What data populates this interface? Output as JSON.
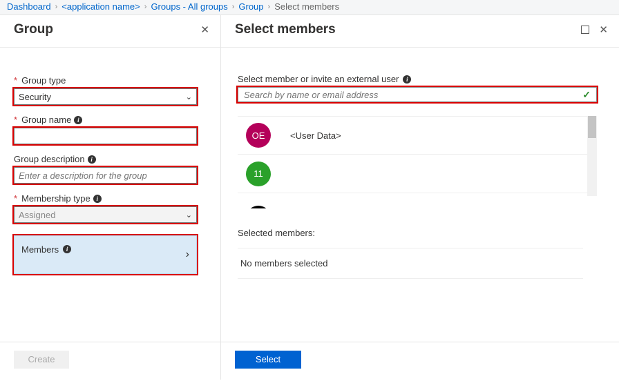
{
  "breadcrumb": {
    "dashboard": "Dashboard",
    "app_name": "<application name>",
    "groups_all": "Groups - All groups",
    "group": "Group",
    "select_members": "Select members"
  },
  "left": {
    "title": "Group",
    "group_type_label": "Group type",
    "group_type_value": "Security",
    "group_name_label": "Group name",
    "group_name_value": "",
    "group_desc_label": "Group description",
    "group_desc_placeholder": "Enter a description for the group",
    "membership_type_label": "Membership type",
    "membership_type_value": "Assigned",
    "members_label": "Members",
    "create_label": "Create"
  },
  "right": {
    "title": "Select members",
    "search_label": "Select member or invite an external user",
    "search_placeholder": "Search by name or email address",
    "members": [
      {
        "initials": "OE",
        "color": "#b4005a",
        "name": "<User Data>"
      },
      {
        "initials": "11",
        "color": "#2aa12a",
        "name": ""
      }
    ],
    "selected_members_label": "Selected members:",
    "no_members_text": "No members selected",
    "select_button": "Select"
  }
}
